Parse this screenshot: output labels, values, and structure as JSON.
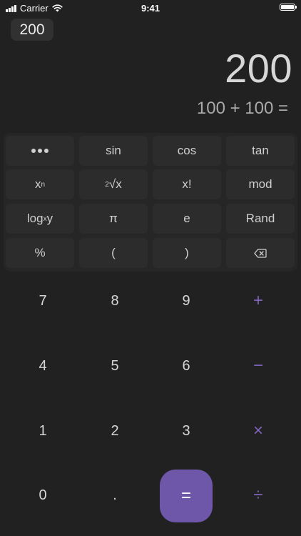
{
  "status_bar": {
    "carrier": "Carrier",
    "time": "9:41"
  },
  "memory": {
    "value": "200"
  },
  "display": {
    "result": "200",
    "expression": "100 + 100 ="
  },
  "scientific_keys": {
    "sin": "sin",
    "cos": "cos",
    "tan": "tan",
    "power_base": "x",
    "power_exp": "n",
    "root_index": "2",
    "root_radicand": "√x",
    "factorial": "x!",
    "mod": "mod",
    "log_base": "log",
    "log_sub": "x",
    "log_arg": "y",
    "pi": "π",
    "e": "e",
    "rand": "Rand",
    "percent": "%",
    "open_paren": "(",
    "close_paren": ")"
  },
  "number_keys": {
    "seven": "7",
    "eight": "8",
    "nine": "9",
    "four": "4",
    "five": "5",
    "six": "6",
    "one": "1",
    "two": "2",
    "three": "3",
    "zero": "0",
    "decimal": "."
  },
  "operator_keys": {
    "plus": "+",
    "minus": "−",
    "multiply": "×",
    "divide": "÷",
    "equals": "="
  },
  "colors": {
    "background": "#212121",
    "accent": "#6e56a8",
    "operator": "#7e64b8"
  },
  "icons": {
    "more": "more-dots-icon",
    "backspace": "backspace-icon",
    "signal": "signal-icon",
    "wifi": "wifi-icon",
    "battery": "battery-icon"
  }
}
